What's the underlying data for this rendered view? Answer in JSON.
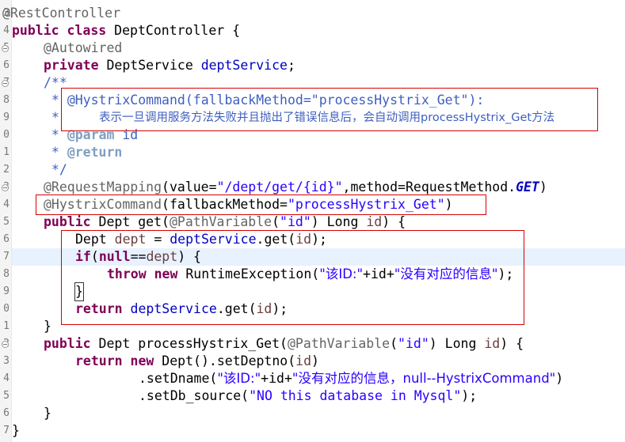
{
  "editor": {
    "line_numbers": [
      "3",
      "4",
      "5",
      "6",
      "7",
      "8",
      "9",
      "0",
      "1",
      "2",
      "3",
      "4",
      "5",
      "6",
      "7",
      "8",
      "9",
      "0",
      "1",
      "2",
      "3",
      "4",
      "5",
      "6",
      "7"
    ],
    "annotations": {
      "rest_controller": "@RestController",
      "autowired": "@Autowired",
      "request_mapping": "@RequestMapping",
      "hystrix_command": "@HystrixCommand",
      "path_variable": "@PathVariable"
    },
    "keywords": {
      "public": "public",
      "class": "class",
      "private": "private",
      "if": "if",
      "null": "null",
      "throw": "throw",
      "new": "new",
      "return": "return"
    },
    "code": {
      "class_name": " DeptController {",
      "service_type": " DeptService ",
      "service_field": "deptService",
      "semicolon": ";",
      "javadoc_open": "/**",
      "javadoc_star": " * ",
      "javadoc_star_only": " *",
      "javadoc_hystrix": "@HystrixCommand(fallbackMethod=\"processHystrix_Get\"):",
      "javadoc_desc": "表示一旦调用服务方法失败并且抛出了错误信息后，会自动调用processHystrix_Get方法",
      "javadoc_param_tag": "@param",
      "javadoc_param_name": " id",
      "javadoc_return_tag": "@return",
      "javadoc_close": " */",
      "rm_open": "(value=",
      "rm_path": "\"/dept/get/{id}\"",
      "rm_method": ",method=RequestMethod.",
      "rm_get": "GET",
      "rm_close": ")",
      "hc_open": "(fallbackMethod=",
      "hc_value": "\"processHystrix_Get\"",
      "hc_close": ")",
      "get_sig_1": " Dept get(",
      "pv_open": "(",
      "id_string": "\"id\"",
      "pv_close_long": ") Long ",
      "id_var": "id",
      "sig_end": ") {",
      "dept_type": "Dept ",
      "dept_var": "dept",
      "assign": " = ",
      "get_call": ".get(",
      "if_paren": "(",
      "eqeq": "==",
      "if_close": ") {",
      "runtime_ex": " RuntimeException(",
      "err_prefix": "\"该ID:\"",
      "plus_id_plus": "+id+",
      "err_suffix": "\"没有对应的信息\"",
      "stmt_close": ");",
      "close_brace": "}",
      "fallback_sig": " Dept processHystrix_Get(",
      "new_dept": " Dept().setDeptno(",
      "paren_close": ")",
      "set_dname": ".setDname(",
      "dname_prefix": "\"该ID:\"",
      "dname_suffix": "\"没有对应的信息，null--HystrixCommand\"",
      "set_db_source": ".setDb_source(",
      "db_value": "\"NO this database in Mysql\""
    }
  }
}
